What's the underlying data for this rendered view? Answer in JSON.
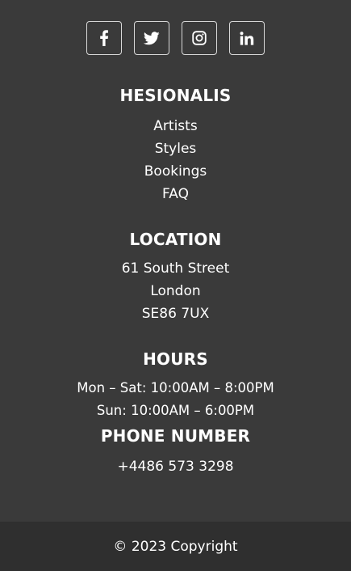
{
  "social": {
    "icons": [
      "facebook-icon",
      "twitter-icon",
      "instagram-icon",
      "linkedin-icon"
    ]
  },
  "brand": {
    "title": "HESIONALIS",
    "links": [
      "Artists",
      "Styles",
      "Bookings",
      "FAQ"
    ]
  },
  "location": {
    "title": "LOCATION",
    "lines": [
      "61 South Street",
      "London",
      "SE86 7UX"
    ]
  },
  "hours": {
    "title": "HOURS",
    "lines": [
      "Mon – Sat: 10:00AM – 8:00PM",
      "Sun: 10:00AM – 6:00PM"
    ]
  },
  "phone": {
    "title": "PHONE NUMBER",
    "number": "+4486 573 3298"
  },
  "copyright": "© 2023 Copyright",
  "colors": {
    "background": "#3a3a3a",
    "copyright_bar": "#2f2f2f",
    "text": "#ffffff"
  }
}
